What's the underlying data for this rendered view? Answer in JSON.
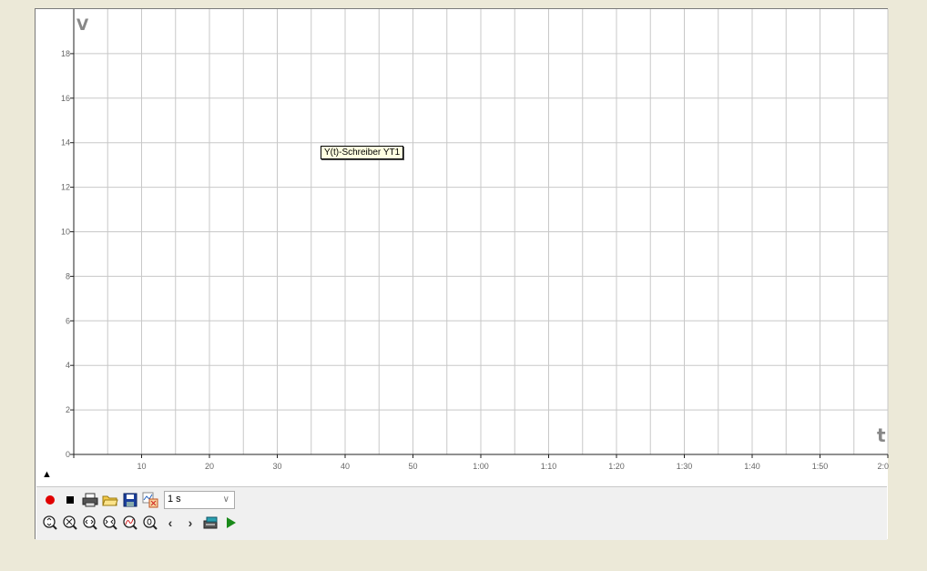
{
  "chart_data": {
    "type": "line",
    "ylabel": "V",
    "xlabel": "t",
    "ylim": [
      0,
      20
    ],
    "xlim": [
      0,
      120
    ],
    "x_unit": "seconds",
    "yticks": [
      0,
      2,
      4,
      6,
      8,
      10,
      12,
      14,
      16,
      18
    ],
    "xticks": [
      {
        "value": 10,
        "label": "10"
      },
      {
        "value": 20,
        "label": "20"
      },
      {
        "value": 30,
        "label": "30"
      },
      {
        "value": 40,
        "label": "40"
      },
      {
        "value": 50,
        "label": "50"
      },
      {
        "value": 60,
        "label": "1:00"
      },
      {
        "value": 70,
        "label": "1:10"
      },
      {
        "value": 80,
        "label": "1:20"
      },
      {
        "value": 90,
        "label": "1:30"
      },
      {
        "value": 100,
        "label": "1:40"
      },
      {
        "value": 110,
        "label": "1:50"
      },
      {
        "value": 120,
        "label": "2:0"
      }
    ],
    "grid": true,
    "series": []
  },
  "tooltip": {
    "text": "Y(t)-Schreiber YT1"
  },
  "toolbar": {
    "interval": "1 s",
    "colors": {
      "record": "#e00000",
      "play": "#1a8a1a"
    }
  }
}
